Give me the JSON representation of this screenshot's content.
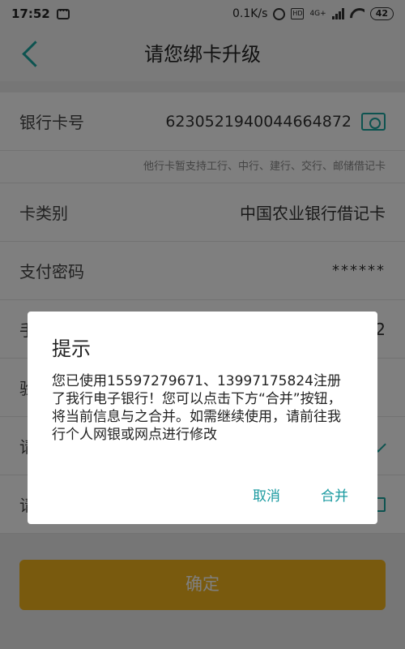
{
  "status_bar": {
    "time": "17:52",
    "network_speed": "0.1K/s",
    "hd_label": "HD",
    "signal_label": "4G+",
    "battery": "42"
  },
  "nav": {
    "title": "请您绑卡升级"
  },
  "form": {
    "card_number_label": "银行卡号",
    "card_number_value": "6230521940044664872",
    "hint": "他行卡暂支持工行、中行、建行、交行、邮储借记卡",
    "card_type_label": "卡类别",
    "card_type_value": "中国农业银行借记卡",
    "password_label": "支付密码",
    "password_value": "******",
    "row4_label_fragment": "手",
    "row4_tail": "2",
    "row5_label_fragment": "验",
    "row6_label_fragment": "请",
    "row7_label_fragment": "请"
  },
  "confirm_button": "确定",
  "dialog": {
    "title": "提示",
    "message": "您已使用15597279671、13997175824注册了我行电子银行！您可以点击下方“合并”按钮，将当前信息与之合并。如需继续使用，请前往我行个人网银或网点进行修改",
    "cancel": "取消",
    "merge": "合并"
  },
  "colors": {
    "accent": "#1aa6a0",
    "button": "#f2b51c"
  }
}
